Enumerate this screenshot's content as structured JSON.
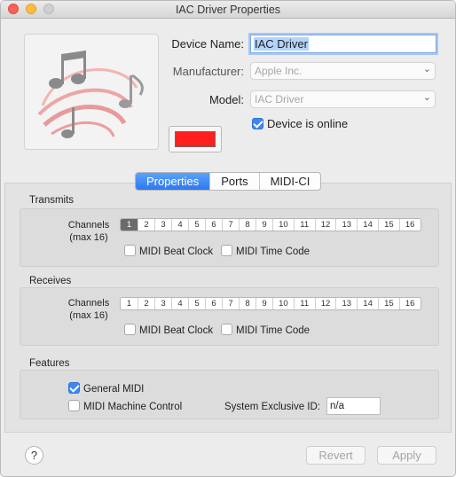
{
  "window": {
    "title": "IAC Driver Properties",
    "controls": [
      "close",
      "minimize",
      "zoom"
    ]
  },
  "device": {
    "name_label": "Device Name:",
    "name_value": "IAC Driver",
    "manufacturer_label": "Manufacturer:",
    "manufacturer_value": "Apple Inc.",
    "model_label": "Model:",
    "model_value": "IAC Driver",
    "online_label": "Device is online",
    "online_checked": true,
    "icon": "midi-notes-icon",
    "color_swatch": "#ff1f1f"
  },
  "tabs": [
    {
      "label": "Properties",
      "active": true
    },
    {
      "label": "Ports",
      "active": false
    },
    {
      "label": "MIDI-CI",
      "active": false
    }
  ],
  "transmits": {
    "heading": "Transmits",
    "channels_label_1": "Channels",
    "channels_label_2": "(max 16)",
    "selected_channels": [
      1
    ],
    "beat_clock_label": "MIDI Beat Clock",
    "beat_clock_checked": false,
    "time_code_label": "MIDI Time Code",
    "time_code_checked": false
  },
  "receives": {
    "heading": "Receives",
    "channels_label_1": "Channels",
    "channels_label_2": "(max 16)",
    "selected_channels": [],
    "beat_clock_label": "MIDI Beat Clock",
    "beat_clock_checked": false,
    "time_code_label": "MIDI Time Code",
    "time_code_checked": false
  },
  "channels": [
    "1",
    "2",
    "3",
    "4",
    "5",
    "6",
    "7",
    "8",
    "9",
    "10",
    "11",
    "12",
    "13",
    "14",
    "15",
    "16"
  ],
  "features": {
    "heading": "Features",
    "general_midi_label": "General MIDI",
    "general_midi_checked": true,
    "machine_control_label": "MIDI Machine Control",
    "machine_control_checked": false,
    "sysex_label": "System Exclusive ID:",
    "sysex_value": "n/a"
  },
  "footer": {
    "help_label": "?",
    "revert_label": "Revert",
    "apply_label": "Apply"
  }
}
